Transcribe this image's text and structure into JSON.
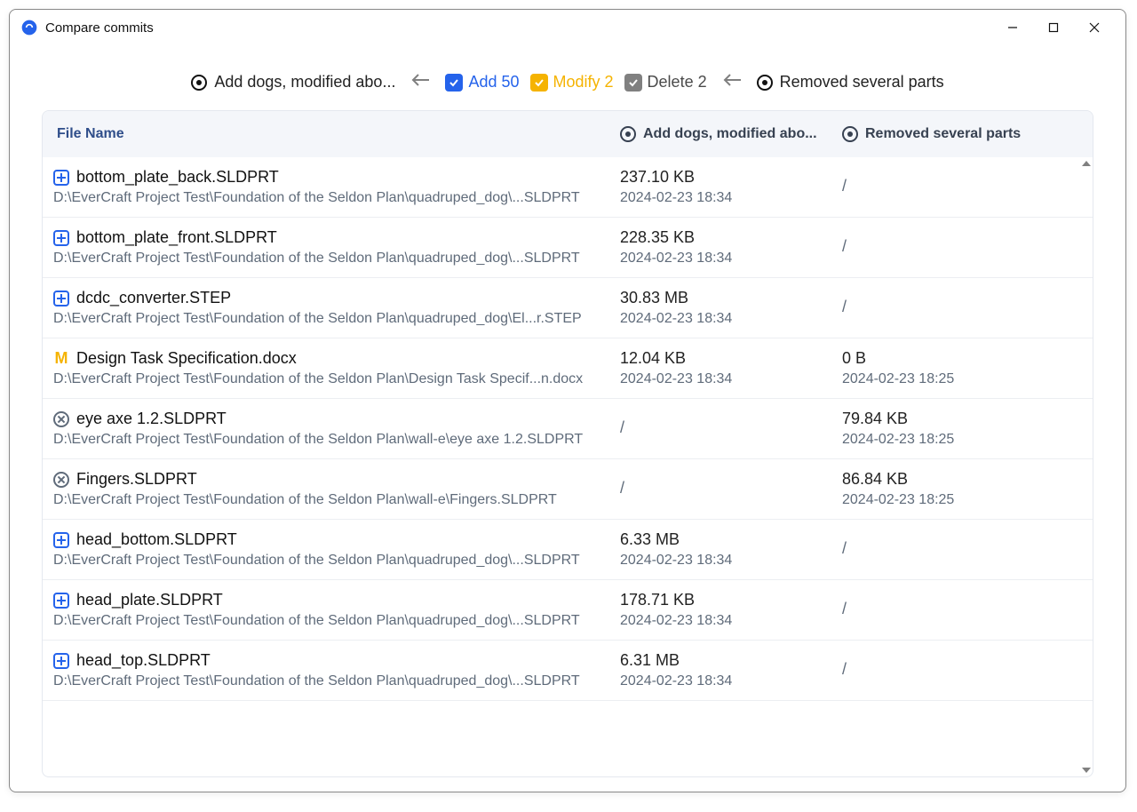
{
  "window": {
    "title": "Compare commits"
  },
  "compare": {
    "left_commit": "Add dogs, modified abo...",
    "right_commit": "Removed several parts",
    "filters": {
      "add": {
        "label": "Add 50"
      },
      "modify": {
        "label": "Modify 2"
      },
      "delete": {
        "label": "Delete 2"
      }
    }
  },
  "columns": {
    "name": "File Name",
    "a": "Add dogs, modified abo...",
    "b": "Removed several parts"
  },
  "rows": [
    {
      "kind": "add",
      "name": "bottom_plate_back.SLDPRT",
      "path": "D:\\EverCraft Project Test\\Foundation of the Seldon Plan\\quadruped_dog\\...SLDPRT",
      "a_size": "237.10 KB",
      "a_date": "2024-02-23 18:34",
      "b_size": "/",
      "b_date": ""
    },
    {
      "kind": "add",
      "name": "bottom_plate_front.SLDPRT",
      "path": "D:\\EverCraft Project Test\\Foundation of the Seldon Plan\\quadruped_dog\\...SLDPRT",
      "a_size": "228.35 KB",
      "a_date": "2024-02-23 18:34",
      "b_size": "/",
      "b_date": ""
    },
    {
      "kind": "add",
      "name": "dcdc_converter.STEP",
      "path": "D:\\EverCraft Project Test\\Foundation of the Seldon Plan\\quadruped_dog\\El...r.STEP",
      "a_size": "30.83 MB",
      "a_date": "2024-02-23 18:34",
      "b_size": "/",
      "b_date": ""
    },
    {
      "kind": "mod",
      "name": "Design Task Specification.docx",
      "path": "D:\\EverCraft Project Test\\Foundation of the Seldon Plan\\Design Task Specif...n.docx",
      "a_size": "12.04 KB",
      "a_date": "2024-02-23 18:34",
      "b_size": "0 B",
      "b_date": "2024-02-23 18:25"
    },
    {
      "kind": "del",
      "name": "eye axe 1.2.SLDPRT",
      "path": "D:\\EverCraft Project Test\\Foundation of the Seldon Plan\\wall-e\\eye axe 1.2.SLDPRT",
      "a_size": "/",
      "a_date": "",
      "b_size": "79.84 KB",
      "b_date": "2024-02-23 18:25"
    },
    {
      "kind": "del",
      "name": "Fingers.SLDPRT",
      "path": "D:\\EverCraft Project Test\\Foundation of the Seldon Plan\\wall-e\\Fingers.SLDPRT",
      "a_size": "/",
      "a_date": "",
      "b_size": "86.84 KB",
      "b_date": "2024-02-23 18:25"
    },
    {
      "kind": "add",
      "name": "head_bottom.SLDPRT",
      "path": "D:\\EverCraft Project Test\\Foundation of the Seldon Plan\\quadruped_dog\\...SLDPRT",
      "a_size": "6.33 MB",
      "a_date": "2024-02-23 18:34",
      "b_size": "/",
      "b_date": ""
    },
    {
      "kind": "add",
      "name": "head_plate.SLDPRT",
      "path": "D:\\EverCraft Project Test\\Foundation of the Seldon Plan\\quadruped_dog\\...SLDPRT",
      "a_size": "178.71 KB",
      "a_date": "2024-02-23 18:34",
      "b_size": "/",
      "b_date": ""
    },
    {
      "kind": "add",
      "name": "head_top.SLDPRT",
      "path": "D:\\EverCraft Project Test\\Foundation of the Seldon Plan\\quadruped_dog\\...SLDPRT",
      "a_size": "6.31 MB",
      "a_date": "2024-02-23 18:34",
      "b_size": "/",
      "b_date": ""
    }
  ]
}
